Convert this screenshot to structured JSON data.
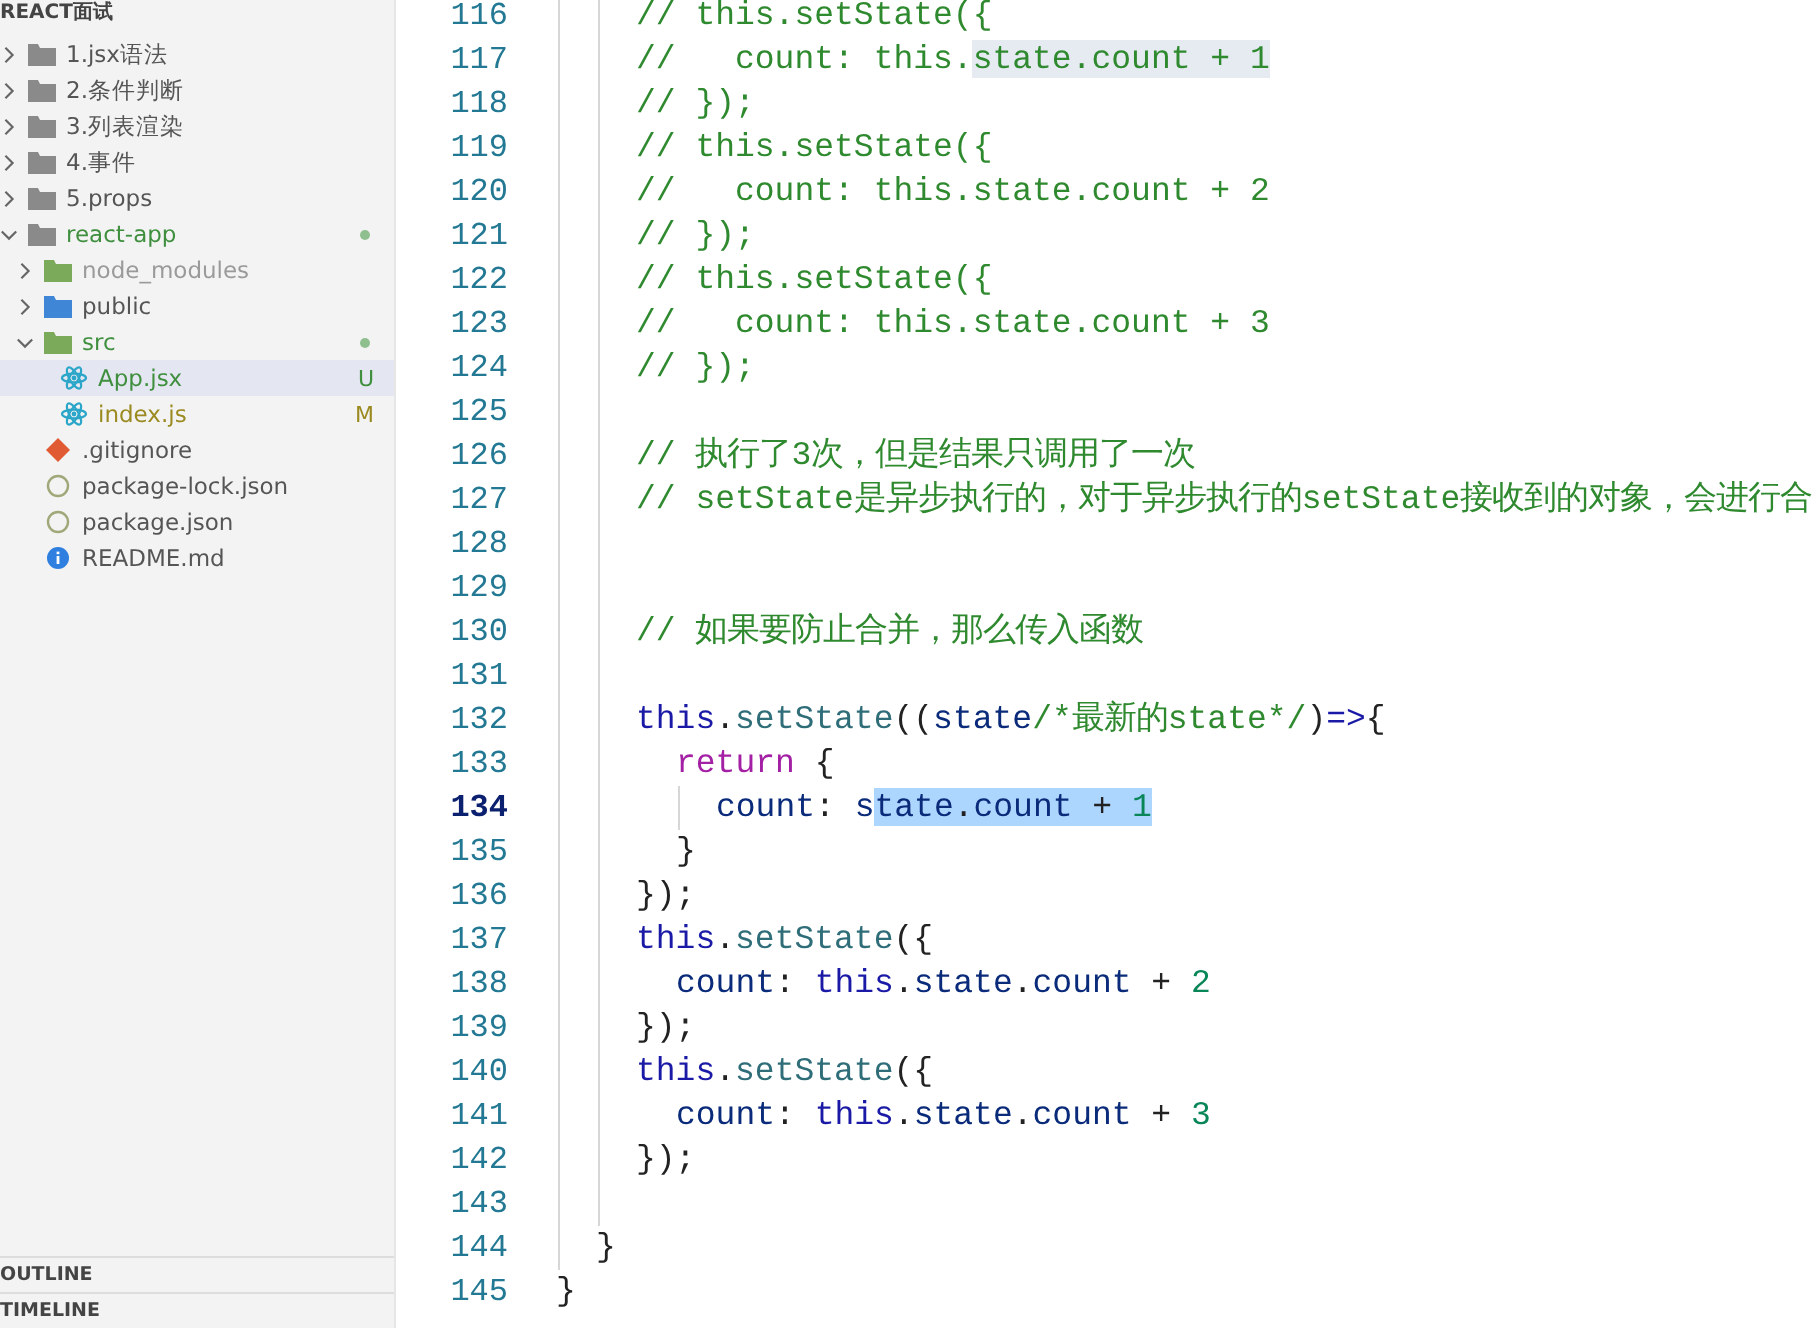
{
  "sidebar": {
    "title": "REACT面试",
    "tree": [
      {
        "label": "1.jsx语法",
        "kind": "folder",
        "expanded": false,
        "color": "#555555",
        "dot": false
      },
      {
        "label": "2.条件判断",
        "kind": "folder",
        "expanded": false,
        "color": "#555555",
        "dot": false
      },
      {
        "label": "3.列表渲染",
        "kind": "folder",
        "expanded": false,
        "color": "#555555",
        "dot": false
      },
      {
        "label": "4.事件",
        "kind": "folder",
        "expanded": false,
        "color": "#555555",
        "dot": false
      },
      {
        "label": "5.props",
        "kind": "folder",
        "expanded": false,
        "color": "#555555",
        "dot": false
      },
      {
        "label": "react-app",
        "kind": "folder",
        "expanded": true,
        "color": "#3f8f3f",
        "dot": true,
        "children": [
          {
            "label": "node_modules",
            "kind": "folder-green",
            "expanded": false,
            "color": "#9a9a9a",
            "dot": false
          },
          {
            "label": "public",
            "kind": "folder-blue",
            "expanded": false,
            "color": "#555555",
            "dot": false
          },
          {
            "label": "src",
            "kind": "folder-green",
            "expanded": true,
            "color": "#3f8f3f",
            "dot": true,
            "children": [
              {
                "label": "App.jsx",
                "kind": "react",
                "color": "#3f8f3f",
                "dot": false,
                "badge": "U",
                "selected": true
              },
              {
                "label": "index.js",
                "kind": "react",
                "color": "#9a8a20",
                "dot": false,
                "badge": "M",
                "selected": false
              }
            ]
          },
          {
            "label": ".gitignore",
            "kind": "git",
            "color": "#555555",
            "dot": false
          },
          {
            "label": "package-lock.json",
            "kind": "json",
            "color": "#555555",
            "dot": false
          },
          {
            "label": "package.json",
            "kind": "json",
            "color": "#555555",
            "dot": false
          },
          {
            "label": "README.md",
            "kind": "info",
            "color": "#555555",
            "dot": false
          }
        ]
      }
    ],
    "sections": [
      {
        "label": "OUTLINE"
      },
      {
        "label": "TIMELINE"
      }
    ]
  },
  "editor": {
    "lines": [
      {
        "number": "116",
        "tokens": [
          {
            "kind": "comment",
            "text": "    // this.setState({"
          }
        ]
      },
      {
        "number": "117",
        "tokens": [
          {
            "kind": "comment",
            "text": "    //   count: this."
          },
          {
            "kind": "comment",
            "text": "state.count + 1",
            "matched": true
          }
        ]
      },
      {
        "number": "118",
        "tokens": [
          {
            "kind": "comment",
            "text": "    // });"
          }
        ]
      },
      {
        "number": "119",
        "tokens": [
          {
            "kind": "comment",
            "text": "    // this.setState({"
          }
        ]
      },
      {
        "number": "120",
        "tokens": [
          {
            "kind": "comment",
            "text": "    //   count: this.state.count + 2"
          }
        ]
      },
      {
        "number": "121",
        "tokens": [
          {
            "kind": "comment",
            "text": "    // });"
          }
        ]
      },
      {
        "number": "122",
        "tokens": [
          {
            "kind": "comment",
            "text": "    // this.setState({"
          }
        ]
      },
      {
        "number": "123",
        "tokens": [
          {
            "kind": "comment",
            "text": "    //   count: this.state.count + 3"
          }
        ]
      },
      {
        "number": "124",
        "tokens": [
          {
            "kind": "comment",
            "text": "    // });"
          }
        ]
      },
      {
        "number": "125"
      },
      {
        "number": "126",
        "tokens": [
          {
            "kind": "comment",
            "text": "    // 执行了3次，但是结果只调用了一次"
          }
        ]
      },
      {
        "number": "127",
        "tokens": [
          {
            "kind": "comment",
            "text": "    // setState是异步执行的，对于异步执行的setState接收到的对象，会进行合"
          }
        ]
      },
      {
        "number": "128"
      },
      {
        "number": "129"
      },
      {
        "number": "130",
        "tokens": [
          {
            "kind": "comment",
            "text": "    // 如果要防止合并，那么传入函数"
          }
        ]
      },
      {
        "number": "131"
      },
      {
        "number": "132",
        "tokens": [
          {
            "kind": "keyword",
            "text": "    this"
          },
          {
            "kind": "punct",
            "text": "."
          },
          {
            "kind": "method",
            "text": "setState"
          },
          {
            "kind": "punct",
            "text": "(("
          },
          {
            "kind": "variable",
            "text": "state"
          },
          {
            "kind": "comment",
            "text": "/*最新的state*/"
          },
          {
            "kind": "punct",
            "text": ")"
          },
          {
            "kind": "keyword",
            "text": "=>"
          },
          {
            "kind": "punct",
            "text": "{"
          }
        ]
      },
      {
        "number": "133",
        "tokens": [
          {
            "kind": "control",
            "text": "      return"
          },
          {
            "kind": "punct",
            "text": " {"
          }
        ]
      },
      {
        "number": "134",
        "current": true,
        "tokens": [
          {
            "kind": "variable",
            "text": "        count"
          },
          {
            "kind": "punct",
            "text": ": "
          },
          {
            "kind": "variable",
            "text": "s"
          },
          {
            "kind": "variable",
            "text": "tate",
            "selected": true
          },
          {
            "kind": "punct",
            "text": ".",
            "selected": true
          },
          {
            "kind": "variable",
            "text": "count",
            "selected": true
          },
          {
            "kind": "punct",
            "text": " + ",
            "selected": true
          },
          {
            "kind": "number",
            "text": "1",
            "selected": true
          }
        ]
      },
      {
        "number": "135",
        "tokens": [
          {
            "kind": "punct",
            "text": "      }"
          }
        ]
      },
      {
        "number": "136",
        "tokens": [
          {
            "kind": "punct",
            "text": "    });"
          }
        ]
      },
      {
        "number": "137",
        "tokens": [
          {
            "kind": "keyword",
            "text": "    this"
          },
          {
            "kind": "punct",
            "text": "."
          },
          {
            "kind": "method",
            "text": "setState"
          },
          {
            "kind": "punct",
            "text": "({"
          }
        ]
      },
      {
        "number": "138",
        "tokens": [
          {
            "kind": "variable",
            "text": "      count"
          },
          {
            "kind": "punct",
            "text": ": "
          },
          {
            "kind": "keyword",
            "text": "this"
          },
          {
            "kind": "punct",
            "text": "."
          },
          {
            "kind": "variable",
            "text": "state"
          },
          {
            "kind": "punct",
            "text": "."
          },
          {
            "kind": "variable",
            "text": "count"
          },
          {
            "kind": "punct",
            "text": " + "
          },
          {
            "kind": "number",
            "text": "2"
          }
        ]
      },
      {
        "number": "139",
        "tokens": [
          {
            "kind": "punct",
            "text": "    });"
          }
        ]
      },
      {
        "number": "140",
        "tokens": [
          {
            "kind": "keyword",
            "text": "    this"
          },
          {
            "kind": "punct",
            "text": "."
          },
          {
            "kind": "method",
            "text": "setState"
          },
          {
            "kind": "punct",
            "text": "({"
          }
        ]
      },
      {
        "number": "141",
        "tokens": [
          {
            "kind": "variable",
            "text": "      count"
          },
          {
            "kind": "punct",
            "text": ": "
          },
          {
            "kind": "keyword",
            "text": "this"
          },
          {
            "kind": "punct",
            "text": "."
          },
          {
            "kind": "variable",
            "text": "state"
          },
          {
            "kind": "punct",
            "text": "."
          },
          {
            "kind": "variable",
            "text": "count"
          },
          {
            "kind": "punct",
            "text": " + "
          },
          {
            "kind": "number",
            "text": "3"
          }
        ]
      },
      {
        "number": "142",
        "tokens": [
          {
            "kind": "punct",
            "text": "    });"
          }
        ]
      },
      {
        "number": "143"
      },
      {
        "number": "144",
        "tokens": [
          {
            "kind": "punct",
            "text": "  }"
          }
        ]
      },
      {
        "number": "145",
        "tokens": [
          {
            "kind": "punct",
            "text": "}"
          }
        ]
      }
    ]
  }
}
